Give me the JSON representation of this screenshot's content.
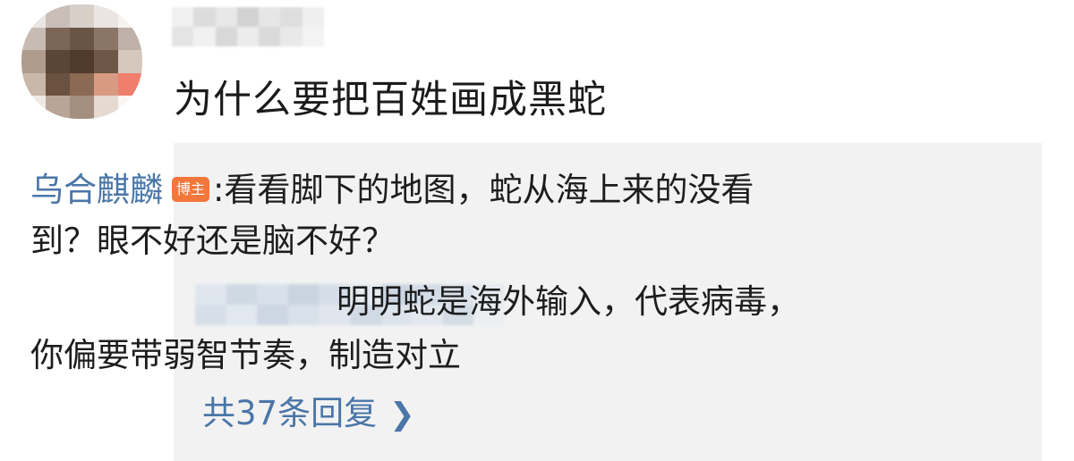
{
  "comment": {
    "text": "为什么要把百姓画成黑蛇"
  },
  "reply_preview": {
    "author": "乌合麒麟",
    "badge": "博主",
    "first_reply_line1": ":看看脚下的地图，蛇从海上来的没看",
    "first_reply_line2": "到？眼不好还是脑不好？",
    "second_reply_line1": "明明蛇是海外输入，代表病毒，",
    "second_reply_line2": "你偏要带弱智节奏，制造对立"
  },
  "more_replies": {
    "label": "共37条回复",
    "icon": "chevron-right-icon"
  },
  "colors": {
    "link": "#4a76a8",
    "badge": "#f2773a",
    "reply_bg": "#f2f2f2",
    "text": "#1d1d1d"
  }
}
